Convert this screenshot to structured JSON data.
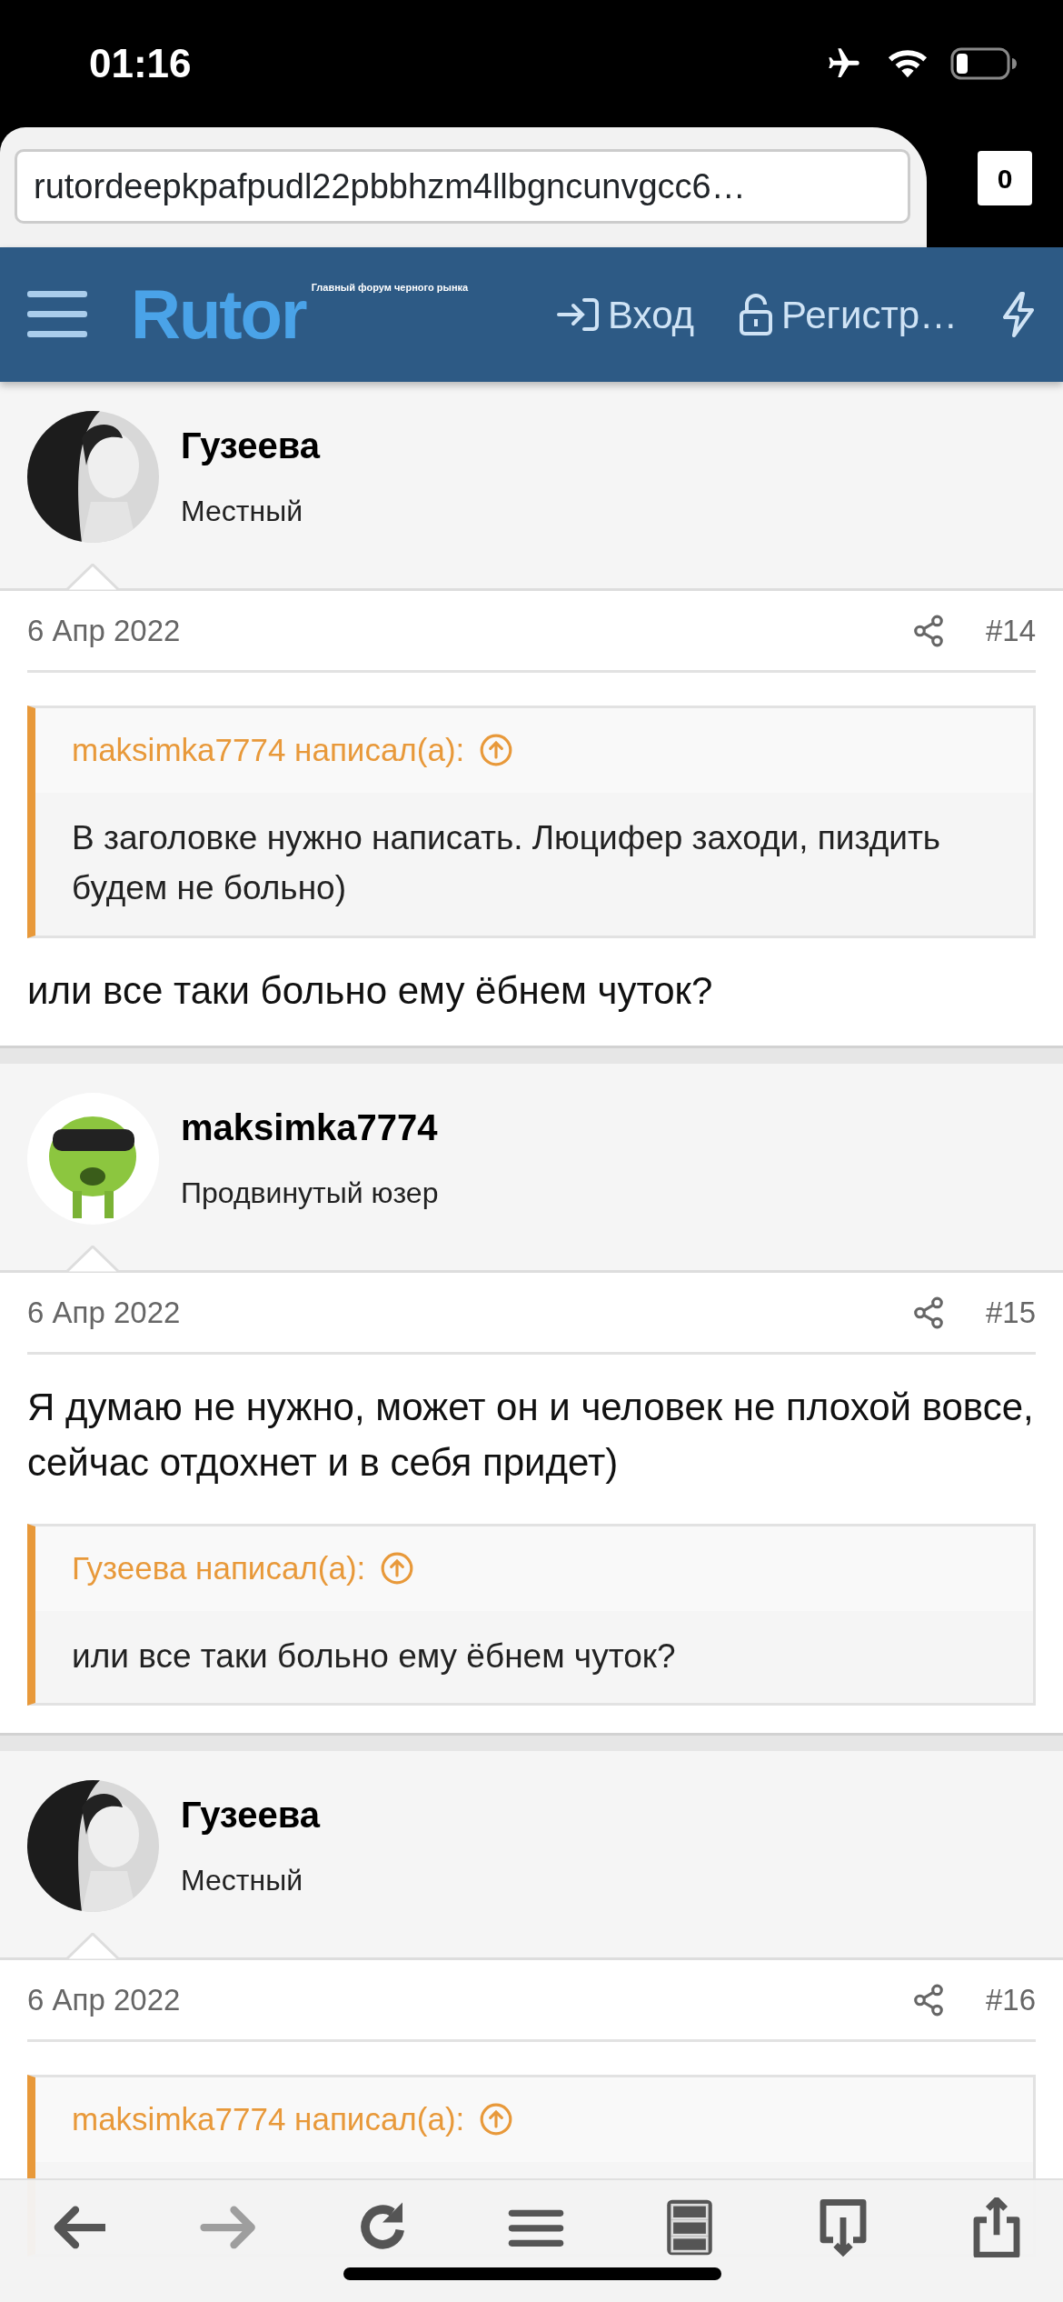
{
  "status_bar": {
    "time": "01:16"
  },
  "browser": {
    "url": "rutordeepkpafpudl22pbbhzm4llbgncunvgcc6…",
    "tab_count": "0"
  },
  "site_nav": {
    "logo": "Rutor",
    "tagline": "Главный форум черного рынка",
    "login": "Вход",
    "register": "Регистр…"
  },
  "posts": [
    {
      "author": "Гузеева",
      "rank": "Местный",
      "avatar": {
        "kind": "picture"
      },
      "date": "6 Апр 2022",
      "number": "#14",
      "blocks": [
        {
          "kind": "quote",
          "author": "maksimka7774 написал(а):",
          "text": "В заголовке нужно написать. Люцифер заходи, пиздить будем не больно)"
        },
        {
          "kind": "text",
          "text": "или все таки больно ему ёбнем чуток?"
        }
      ]
    },
    {
      "author": "maksimka7774",
      "rank": "Продвинутый юзер",
      "avatar": {
        "kind": "picture"
      },
      "date": "6 Апр 2022",
      "number": "#15",
      "blocks": [
        {
          "kind": "text",
          "text": "Я думаю не нужно, может он и человек не плохой вовсе, сейчас отдохнет и в себя придет)"
        },
        {
          "kind": "quote",
          "author": "Гузеева написал(а):",
          "text": "или все таки больно ему ёбнем чуток?"
        }
      ]
    },
    {
      "author": "Гузеева",
      "rank": "Местный",
      "avatar": {
        "kind": "picture"
      },
      "date": "6 Апр 2022",
      "number": "#16",
      "blocks": [
        {
          "kind": "quote",
          "author": "maksimka7774 написал(а):"
        }
      ]
    }
  ],
  "toolbar": [
    {
      "kind": "back",
      "disabled": false
    },
    {
      "kind": "forward",
      "disabled": true
    },
    {
      "kind": "reload",
      "disabled": false
    },
    {
      "kind": "menu",
      "disabled": false
    },
    {
      "kind": "drawer",
      "disabled": false
    },
    {
      "kind": "download",
      "disabled": false
    },
    {
      "kind": "share",
      "disabled": false
    }
  ]
}
